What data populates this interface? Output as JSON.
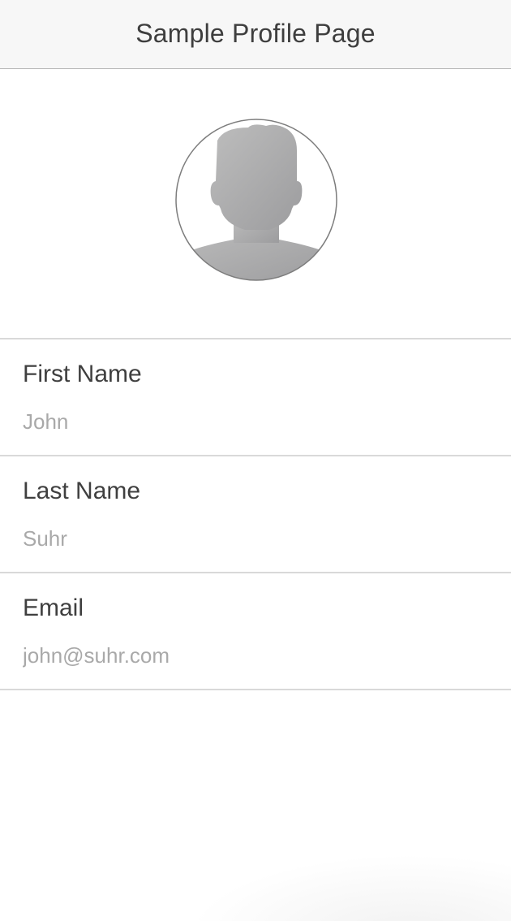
{
  "nav": {
    "title": "Sample Profile Page"
  },
  "avatar": {
    "icon": "person-silhouette-icon"
  },
  "fields": [
    {
      "label": "First Name",
      "value": "John"
    },
    {
      "label": "Last Name",
      "value": "Suhr"
    },
    {
      "label": "Email",
      "value": "john@suhr.com"
    }
  ],
  "colors": {
    "nav_background": "#f7f7f7",
    "label_text": "#3f3f3f",
    "value_text": "#a9a9a9",
    "separator": "#d9d9d9",
    "avatar_fill": "#a9a9ab"
  }
}
